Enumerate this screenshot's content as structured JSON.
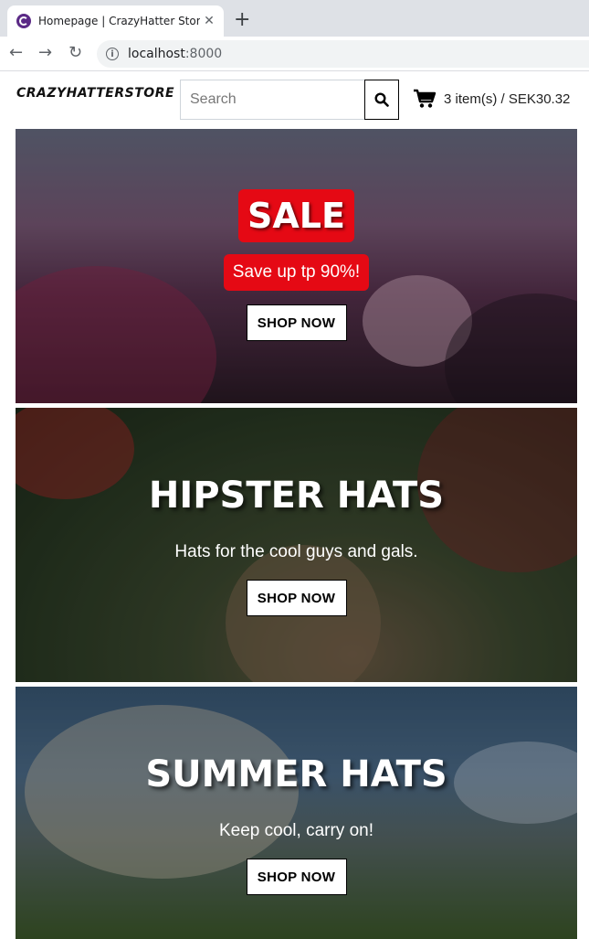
{
  "browser": {
    "tab_title": "Homepage | CrazyHatter Store",
    "close_glyph": "✕",
    "new_tab_glyph": "+",
    "back_glyph": "←",
    "forward_glyph": "→",
    "reload_glyph": "↻",
    "url_host": "localhost",
    "url_port": ":8000"
  },
  "header": {
    "logo": "CRAZYHATTERSTORE",
    "search_placeholder": "Search",
    "cart_text": "3 item(s) / SEK30.32"
  },
  "banners": [
    {
      "badge": "SALE",
      "subtitle": "Save up tp 90%!",
      "button": "SHOP NOW"
    },
    {
      "title": "HIPSTER HATS",
      "subtitle": "Hats for the cool guys and gals.",
      "button": "SHOP NOW"
    },
    {
      "title": "SUMMER HATS",
      "subtitle": "Keep cool, carry on!",
      "button": "SHOP NOW"
    }
  ],
  "colors": {
    "accent_red": "#e50914",
    "chrome_bg": "#dee1e6"
  },
  "icons": [
    "favicon-icon",
    "close-icon",
    "plus-icon",
    "back-arrow-icon",
    "forward-arrow-icon",
    "reload-icon",
    "info-icon",
    "search-icon",
    "cart-icon"
  ]
}
